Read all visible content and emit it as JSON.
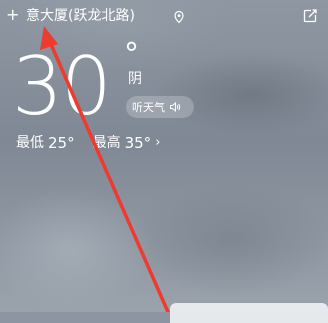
{
  "header": {
    "add_symbol": "+",
    "location": "意大厦(跃龙北路)",
    "location_icon": "location-pin-icon",
    "share_icon": "share-edit-icon"
  },
  "weather": {
    "temperature": "30",
    "degree_symbol": "°",
    "condition": "阴",
    "listen_label": "听天气",
    "low_label": "最低",
    "low_value": "25°",
    "high_label": "最高",
    "high_value": "35°",
    "chevron": "›"
  },
  "annotation": {
    "arrow_color": "#ee3a2f"
  }
}
